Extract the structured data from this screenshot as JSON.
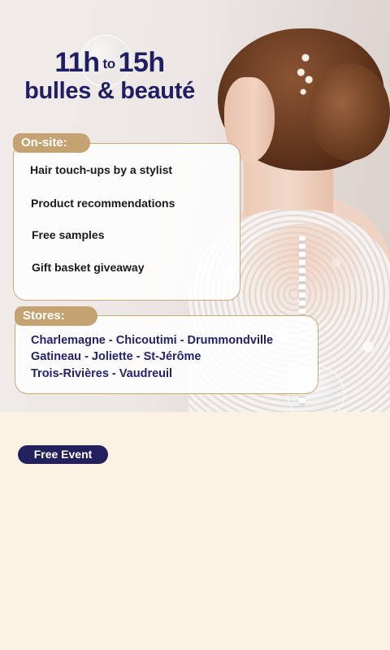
{
  "hero": {
    "time_start": "11h",
    "time_to": "to",
    "time_end": "15h",
    "title": "bulles & beauté"
  },
  "onsite": {
    "label": "On-site:",
    "items": [
      "Hair touch-ups by a stylist",
      "Product recommendations",
      "Free samples",
      "Gift basket giveaway"
    ]
  },
  "stores": {
    "label": "Stores:",
    "lines": [
      "Charlemagne - Chicoutimi - Drummondville",
      "Gatineau - Joliette - St-Jérôme",
      "Trois-Rivières - Vaudreuil"
    ]
  },
  "badge": {
    "label": "Free Event"
  },
  "colors": {
    "navy": "#1f1e63",
    "gold": "#c4a271",
    "cream": "#fcf2e3"
  }
}
